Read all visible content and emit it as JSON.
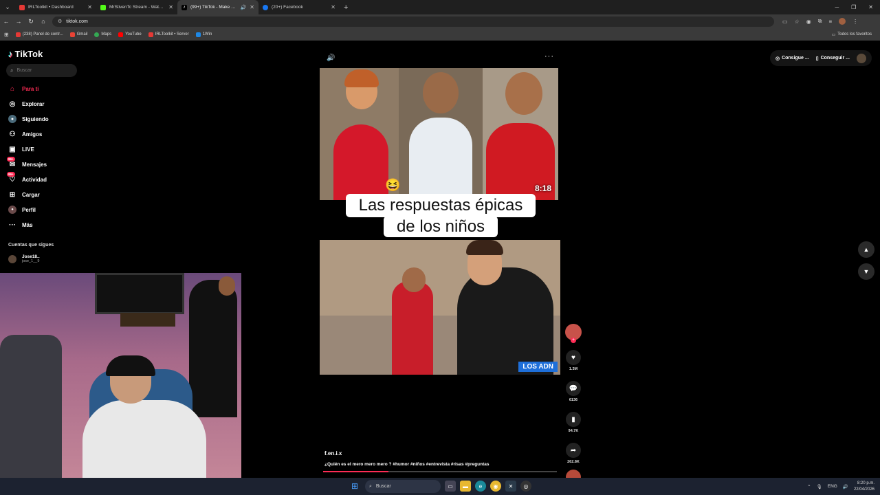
{
  "browser": {
    "tabs": [
      {
        "title": "IRLToolkit • Dashboard",
        "color": "#e53935"
      },
      {
        "title": "MrStivenTc Stream - Watch Liv",
        "color": "#53fc18"
      },
      {
        "title": "(99+) TikTok - Make Your Da",
        "color": "#ffffff",
        "active": true
      },
      {
        "title": "(20+) Facebook",
        "color": "#1877f2"
      }
    ],
    "url": "tiktok.com",
    "bookmarks": [
      {
        "label": "(238) Panel de contr...",
        "color": "#e53935"
      },
      {
        "label": "Gmail",
        "color": "#ea4335"
      },
      {
        "label": "Maps",
        "color": "#34a853"
      },
      {
        "label": "YouTube",
        "color": "#ff0000"
      },
      {
        "label": "IRLToolkit • Server",
        "color": "#e53935"
      },
      {
        "label": "1Win",
        "color": "#1e88e5"
      }
    ],
    "all_bookmarks_label": "Todos los favoritos"
  },
  "tiktok": {
    "logo": "TikTok",
    "search_placeholder": "Buscar",
    "nav": [
      {
        "label": "Para ti",
        "icon": "home-icon",
        "active": true
      },
      {
        "label": "Explorar",
        "icon": "compass-icon"
      },
      {
        "label": "Siguiendo",
        "icon": "following-icon"
      },
      {
        "label": "Amigos",
        "icon": "friends-icon"
      },
      {
        "label": "LIVE",
        "icon": "live-icon"
      },
      {
        "label": "Mensajes",
        "icon": "messages-icon",
        "badge": "99+"
      },
      {
        "label": "Actividad",
        "icon": "activity-icon",
        "badge": "99+"
      },
      {
        "label": "Cargar",
        "icon": "upload-icon"
      },
      {
        "label": "Perfil",
        "icon": "profile-icon"
      },
      {
        "label": "Más",
        "icon": "more-icon"
      }
    ],
    "following_title": "Cuentas que sigues",
    "following": [
      {
        "name": "Jose18..",
        "handle": "jose_1__9"
      }
    ],
    "top_right": {
      "coins_label": "Consigue ...",
      "app_label": "Conseguir ..."
    }
  },
  "video": {
    "caption_line1": "Las respuestas épicas",
    "caption_line2": "de los niños",
    "duration": "8:18",
    "brand": "LOS ADN",
    "author": "f.en.i.x",
    "description": "¿Quién es el mero mero mero ? #humor #niños #entrevista #risas #preguntas",
    "progress": 0.28,
    "likes": "1.3M",
    "comments": "6136",
    "saves": "94.7K",
    "shares": "262.8K"
  },
  "taskbar": {
    "search_label": "Buscar",
    "language": "ENG",
    "time": "8:20 p.m.",
    "date": "22/04/2026"
  }
}
